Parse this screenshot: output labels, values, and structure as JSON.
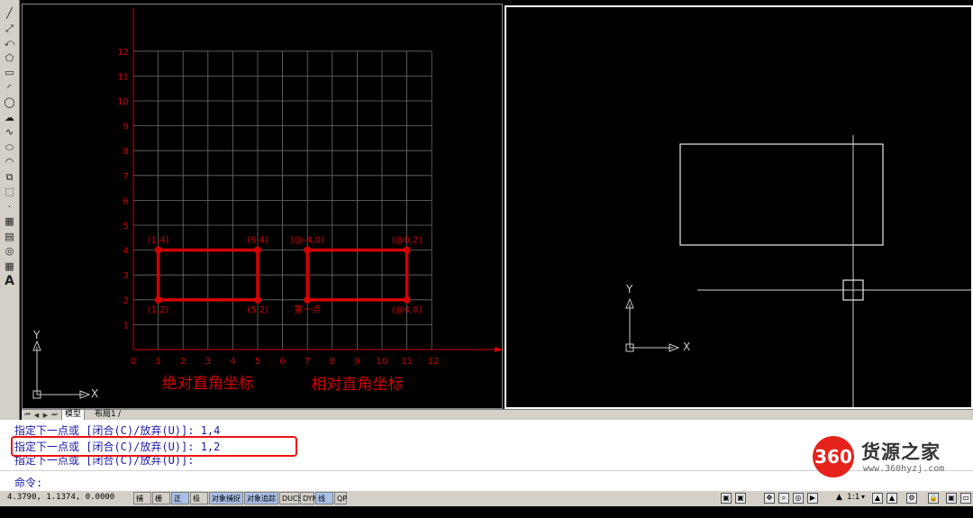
{
  "toolbar": {
    "tools": [
      {
        "icon": "line-icon",
        "glyph": "╱"
      },
      {
        "icon": "construction-line-icon",
        "glyph": "⤢"
      },
      {
        "icon": "polyline-icon",
        "glyph": "⤺"
      },
      {
        "icon": "polygon-icon",
        "glyph": "⬠"
      },
      {
        "icon": "rectangle-icon",
        "glyph": "▭"
      },
      {
        "icon": "arc-icon",
        "glyph": "◜"
      },
      {
        "icon": "circle-icon",
        "glyph": "◯"
      },
      {
        "icon": "revision-cloud-icon",
        "glyph": "☁"
      },
      {
        "icon": "spline-icon",
        "glyph": "∿"
      },
      {
        "icon": "ellipse-icon",
        "glyph": "⬭"
      },
      {
        "icon": "ellipse-arc-icon",
        "glyph": "◠"
      },
      {
        "icon": "insert-block-icon",
        "glyph": "⧉"
      },
      {
        "icon": "make-block-icon",
        "glyph": "⬚"
      },
      {
        "icon": "point-icon",
        "glyph": "·"
      },
      {
        "icon": "hatch-icon",
        "glyph": "▦"
      },
      {
        "icon": "gradient-icon",
        "glyph": "▤"
      },
      {
        "icon": "region-icon",
        "glyph": "◎"
      },
      {
        "icon": "table-icon",
        "glyph": "▦"
      },
      {
        "icon": "multiline-text-icon",
        "glyph": "A"
      }
    ]
  },
  "left_view": {
    "grid_color": "#6e6e6e",
    "accent_color": "#d40000",
    "y_ticks": [
      "1",
      "2",
      "3",
      "4",
      "5",
      "6",
      "7",
      "8",
      "9",
      "10",
      "11",
      "12"
    ],
    "x_ticks": [
      "0",
      "1",
      "2",
      "3",
      "4",
      "5",
      "6",
      "7",
      "8",
      "9",
      "10",
      "11",
      "12"
    ],
    "points_absolute": [
      {
        "label": "(1,4)",
        "x": 1,
        "y": 4
      },
      {
        "label": "(5,4)",
        "x": 5,
        "y": 4
      },
      {
        "label": "(1,2)",
        "x": 1,
        "y": 2
      },
      {
        "label": "(5,2)",
        "x": 5,
        "y": 2
      }
    ],
    "points_relative": [
      {
        "label": "(@-4,0)",
        "x": 7,
        "y": 4
      },
      {
        "label": "(@0,2)",
        "x": 11,
        "y": 4
      },
      {
        "label": "第一点",
        "x": 7,
        "y": 2
      },
      {
        "label": "(@4,0)",
        "x": 11,
        "y": 2
      }
    ],
    "caption_absolute": "绝对直角坐标",
    "caption_relative": "相对直角坐标",
    "ucs_y": "Y",
    "ucs_x": "X"
  },
  "right_view": {
    "ucs_y": "Y",
    "ucs_x": "X"
  },
  "tabs": {
    "model": "模型",
    "layout1": "布局1"
  },
  "command": {
    "line1": "指定下一点或 [闭合(C)/放弃(U)]: 1,4",
    "line2": "指定下一点或 [闭合(C)/放弃(U)]: 1,2",
    "line3": "指定下一点或 [闭合(C)/放弃(U)]:",
    "prompt": "命令:"
  },
  "watermark": {
    "badge": "360",
    "title": "货源之家",
    "url": "www.360hyzj.com"
  },
  "statusbar": {
    "coords": "4.3790, 1.1374, 0.0000",
    "buttons": [
      {
        "label": "捕捉",
        "on": false
      },
      {
        "label": "栅格",
        "on": false
      },
      {
        "label": "正交",
        "on": true
      },
      {
        "label": "极轴",
        "on": false
      },
      {
        "label": "对象捕捉",
        "on": true
      },
      {
        "label": "对象追踪",
        "on": true
      },
      {
        "label": "DUCS",
        "on": false
      },
      {
        "label": "DYN",
        "on": false
      },
      {
        "label": "线宽",
        "on": true
      },
      {
        "label": "QP",
        "on": false
      }
    ],
    "scale": "1:1"
  }
}
